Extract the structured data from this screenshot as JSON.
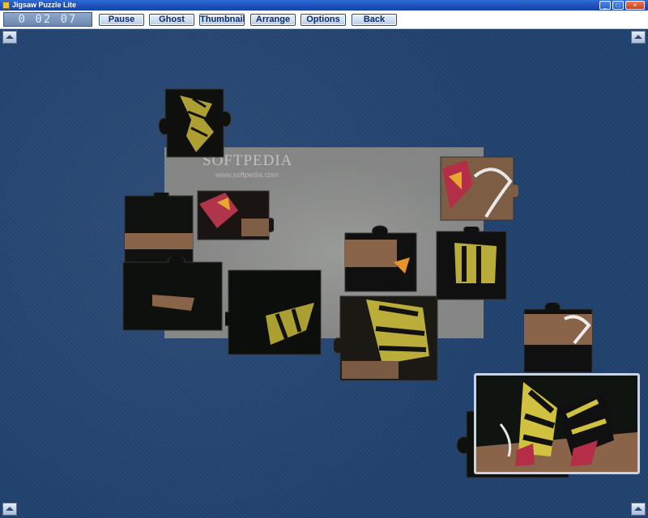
{
  "window": {
    "title": "Jigsaw Puzzle Lite",
    "controls": [
      "_",
      "□",
      "×"
    ]
  },
  "toolbar": {
    "timer": "0 02 07",
    "buttons": [
      {
        "label": "Pause"
      },
      {
        "label": "Ghost"
      },
      {
        "label": "Thumbnail"
      },
      {
        "label": "Arrange"
      },
      {
        "label": "Options"
      },
      {
        "label": "Back"
      }
    ]
  },
  "board": {
    "watermark": "SOFTPEDIA",
    "watermark_url": "www.softpedia.com"
  },
  "colors": {
    "background": "#21426f",
    "toolbar": "#ffffff",
    "button_border": "#27478a",
    "ghost": "#8d8c87",
    "butterfly_yellow": "#d8c83a",
    "bark": "#8a6448"
  },
  "icons": {
    "corner_buttons": "scroll-up-icon"
  }
}
